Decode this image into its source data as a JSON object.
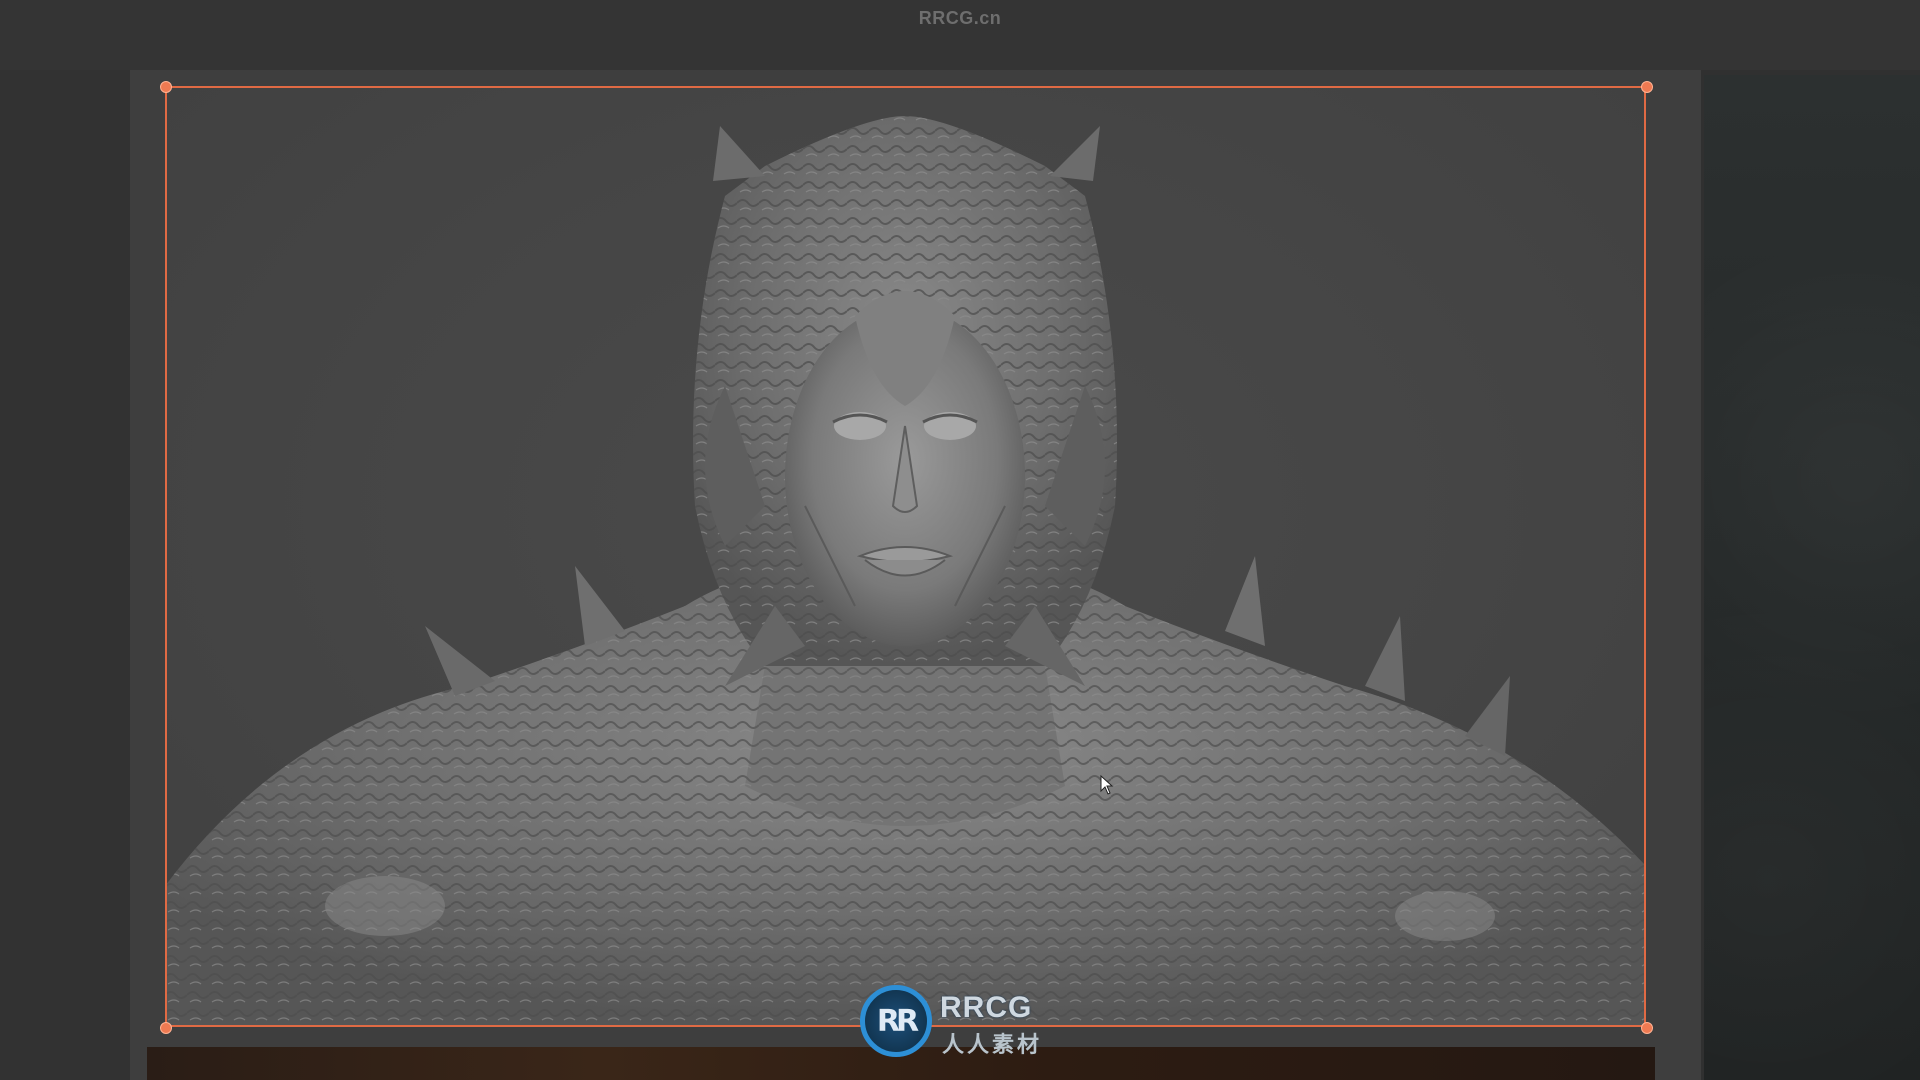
{
  "window": {
    "watermark_top": "RRCG.cn"
  },
  "viewport": {
    "content": "sculpted creature bust",
    "background_color": "#454545",
    "selection_color": "#e06a44"
  },
  "logo": {
    "mark": "RR",
    "name": "RRCG",
    "subtitle": "人人素材",
    "accent": "#2d8fd6"
  }
}
